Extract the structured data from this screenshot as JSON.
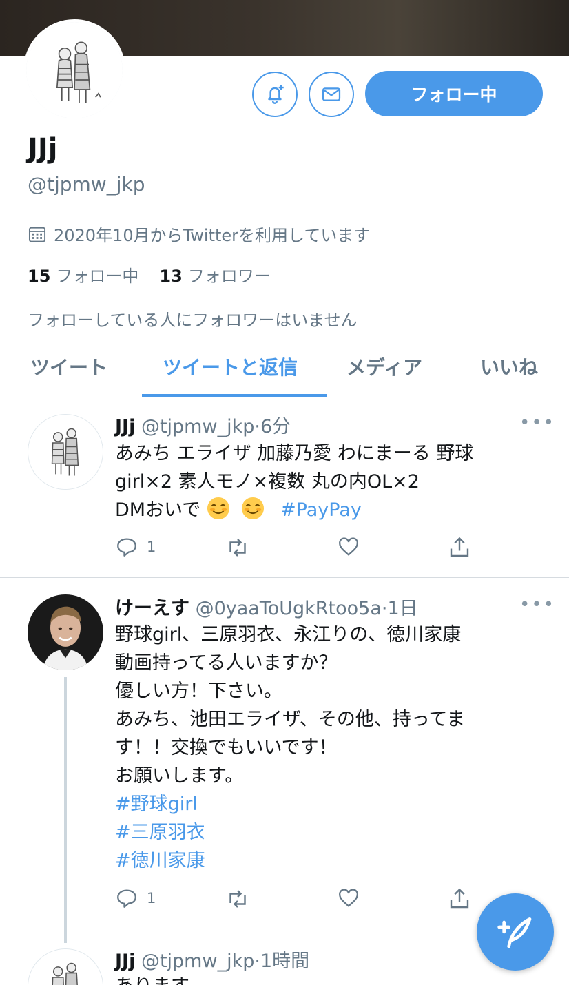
{
  "profile": {
    "name": "JJj",
    "handle": "@tjpmw_jkp",
    "joined": "2020年10月からTwitterを利用しています",
    "following_count": "15",
    "following_label": "フォロー中",
    "followers_count": "13",
    "followers_label": "フォロワー",
    "mutual_note": "フォローしている人にフォロワーはいません",
    "follow_button": "フォロー中"
  },
  "tabs": [
    {
      "label": "ツイート",
      "active": false
    },
    {
      "label": "ツイートと返信",
      "active": true
    },
    {
      "label": "メディア",
      "active": false
    },
    {
      "label": "いいね",
      "active": false
    }
  ],
  "tweets": [
    {
      "name": "JJj",
      "handle": "@tjpmw_jkp",
      "time": "6分",
      "lines": [
        "あみち エライザ  加藤乃愛  わにまーる  野球",
        "girl×2   素人モノ×複数  丸の内OL×2"
      ],
      "line3_text": "DMおいで",
      "hashtag": "#PayPay",
      "reply_count": "1"
    },
    {
      "name": "けーえす",
      "handle": "@0yaaToUgkRtoo5a",
      "time": "1日",
      "lines": [
        "野球girl、三原羽衣、永江りの、徳川家康",
        "動画持ってる人いますか？",
        "優しい方！下さい。",
        "あみち、池田エライザ、その他、持ってま",
        "す！！交換でもいいです！",
        "お願いします。"
      ],
      "hashtags": [
        "#野球girl",
        "#三原羽衣",
        "#徳川家康"
      ],
      "reply_count": "1"
    },
    {
      "name": "JJj",
      "handle": "@tjpmw_jkp",
      "time": "1時間",
      "partial_text": "あります"
    }
  ],
  "separator": "·",
  "more": "•••",
  "colors": {
    "accent": "#4a99e9",
    "muted": "#657786",
    "text": "#14171a"
  }
}
